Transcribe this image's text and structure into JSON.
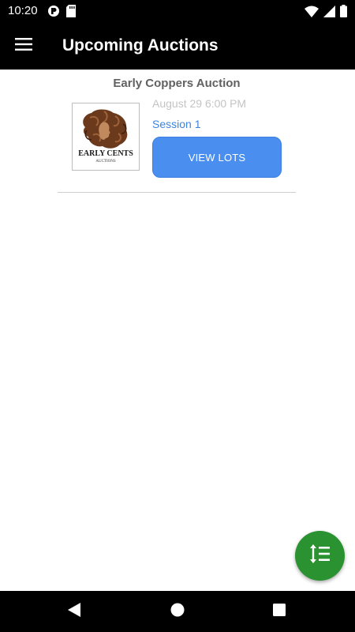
{
  "status_bar": {
    "time": "10:20",
    "icons": [
      "notification-app-icon",
      "sd-card-icon",
      "wifi-icon",
      "cellular-signal-icon",
      "battery-icon"
    ]
  },
  "app_bar": {
    "title": "Upcoming Auctions",
    "menu_icon": "hamburger-menu-icon"
  },
  "auctions": [
    {
      "name": "Early Coppers Auction",
      "logo_text": "EARLY CENTS",
      "logo_subtext": "AUCTIONS",
      "date": "August 29 6:00 PM",
      "session": "Session 1",
      "button_label": "VIEW LOTS"
    }
  ],
  "fab": {
    "icon": "sort-icon"
  },
  "nav_bar": {
    "icons": [
      "back-icon",
      "home-icon",
      "recents-icon"
    ]
  },
  "colors": {
    "bars": "#000000",
    "accent_blue": "#4a8ff0",
    "session_blue": "#3d84dd",
    "fab_green": "#2a9230"
  }
}
